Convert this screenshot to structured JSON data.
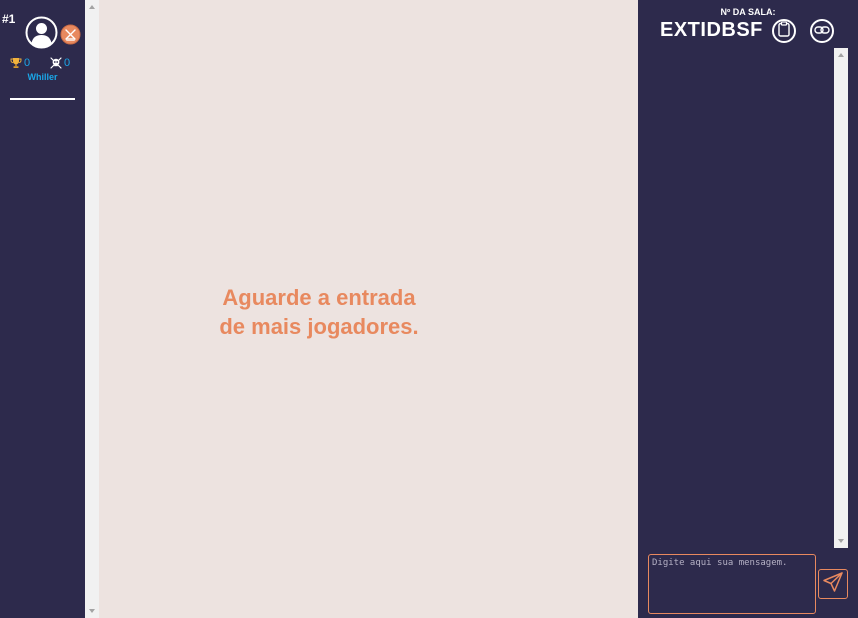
{
  "player": {
    "rank": "#1",
    "name": "Whiller",
    "wins": "0",
    "kills": "0",
    "icons": {
      "avatar": "user-circle-icon",
      "kick": "kick-player-icon",
      "wins": "trophy-icon",
      "kills": "skull-icon"
    }
  },
  "game": {
    "waiting_line1": "Aguarde a entrada",
    "waiting_line2": "de mais jogadores."
  },
  "room": {
    "label": "Nº DA SALA:",
    "code": "EXTIDBSF",
    "copy_icon": "clipboard-icon",
    "link_icon": "link-icon"
  },
  "chat": {
    "placeholder": "Digite aqui sua mensagem.",
    "send_icon": "paper-plane-icon"
  },
  "colors": {
    "background": "#2d2a4c",
    "canvas": "#ede3e0",
    "accent": "#e8895f",
    "stat": "#1aa7e8"
  }
}
